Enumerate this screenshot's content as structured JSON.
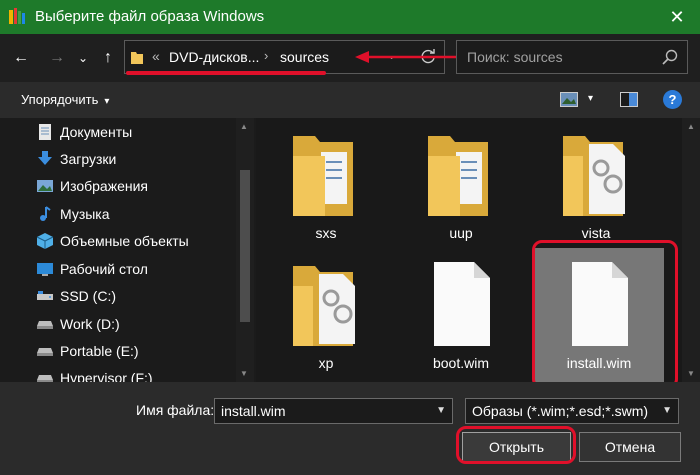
{
  "window": {
    "title": "Выберите файл образа Windows",
    "close_glyph": "✕",
    "accent": "#1e7a2a"
  },
  "nav": {
    "back_glyph": "←",
    "forward_glyph": "→",
    "recent_glyph": "⌄",
    "up_glyph": "↑"
  },
  "address": {
    "overflow_glyph": "«",
    "crumbs": [
      "DVD-дисков...",
      "sources"
    ],
    "separator": "›",
    "dropdown_glyph": "⌄"
  },
  "search": {
    "placeholder": "Поиск: sources"
  },
  "toolbar": {
    "organize_label": "Упорядочить",
    "organize_caret": "▾",
    "view_caret": "▾",
    "help_glyph": "?"
  },
  "sidebar": {
    "items": [
      {
        "label": "Документы",
        "icon": "documents-icon"
      },
      {
        "label": "Загрузки",
        "icon": "downloads-icon"
      },
      {
        "label": "Изображения",
        "icon": "pictures-icon"
      },
      {
        "label": "Музыка",
        "icon": "music-icon"
      },
      {
        "label": "Объемные объекты",
        "icon": "3d-objects-icon"
      },
      {
        "label": "Рабочий стол",
        "icon": "desktop-icon"
      },
      {
        "label": "SSD (C:)",
        "icon": "system-drive-icon"
      },
      {
        "label": "Work (D:)",
        "icon": "drive-icon"
      },
      {
        "label": "Portable (E:)",
        "icon": "drive-icon"
      },
      {
        "label": "Hypervisor (F:)",
        "icon": "drive-icon"
      }
    ]
  },
  "files": [
    {
      "name": "sxs",
      "type": "folder-icon",
      "selected": false
    },
    {
      "name": "uup",
      "type": "folder-icon",
      "selected": false
    },
    {
      "name": "vista",
      "type": "settings-folder-icon",
      "selected": false
    },
    {
      "name": "xp",
      "type": "settings-folder-icon",
      "selected": false
    },
    {
      "name": "boot.wim",
      "type": "file-icon",
      "selected": false
    },
    {
      "name": "install.wim",
      "type": "file-icon",
      "selected": true
    }
  ],
  "bottom": {
    "filename_label": "Имя файла:",
    "filename_value": "install.wim",
    "filter_value": "Образы (*.wim;*.esd;*.swm)",
    "open_label": "Открыть",
    "cancel_label": "Отмена"
  },
  "colors": {
    "annotation_red": "#e0102a",
    "folder_yellow": "#f2c65a",
    "selection_gray": "#777777"
  }
}
